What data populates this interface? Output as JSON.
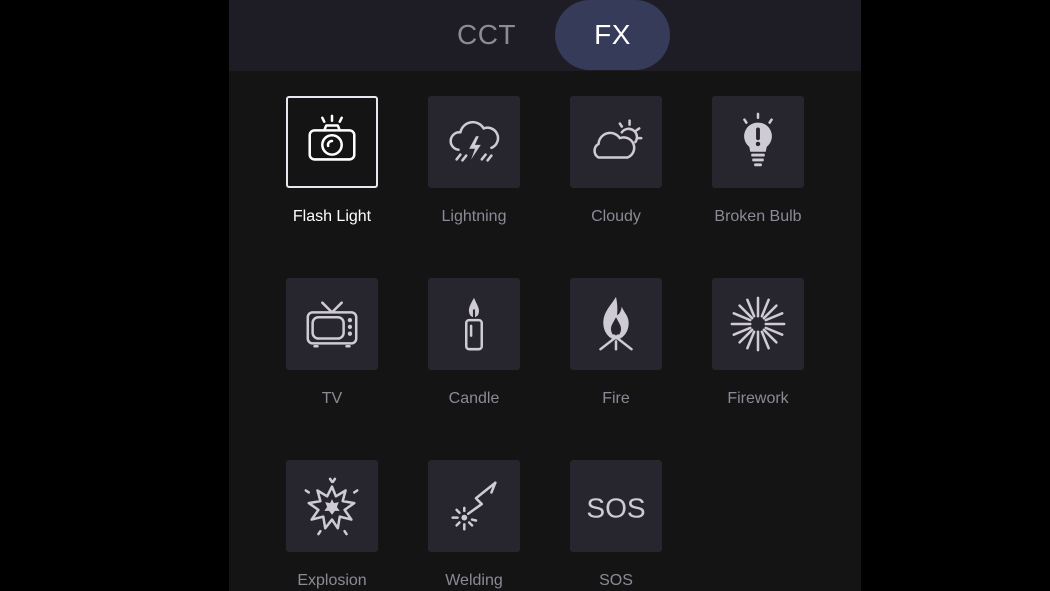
{
  "tabs": [
    {
      "label": "CCT",
      "active": false
    },
    {
      "label": "FX",
      "active": true
    }
  ],
  "effects": [
    {
      "label": "Flash Light",
      "icon": "camera-flash-icon",
      "selected": true
    },
    {
      "label": "Lightning",
      "icon": "lightning-cloud-icon",
      "selected": false
    },
    {
      "label": "Cloudy",
      "icon": "cloudy-icon",
      "selected": false
    },
    {
      "label": "Broken Bulb",
      "icon": "broken-bulb-icon",
      "selected": false
    },
    {
      "label": "TV",
      "icon": "tv-icon",
      "selected": false
    },
    {
      "label": "Candle",
      "icon": "candle-icon",
      "selected": false
    },
    {
      "label": "Fire",
      "icon": "fire-icon",
      "selected": false
    },
    {
      "label": "Firework",
      "icon": "firework-icon",
      "selected": false
    },
    {
      "label": "Explosion",
      "icon": "explosion-icon",
      "selected": false
    },
    {
      "label": "Welding",
      "icon": "welding-icon",
      "selected": false
    },
    {
      "label": "SOS",
      "icon": "sos-icon",
      "selected": false
    }
  ],
  "icon_text": {
    "sos": "SOS"
  },
  "colors": {
    "background": "#000000",
    "panel": "#141414",
    "tabbar": "#1e1d25",
    "active_tab": "#373b5a",
    "tile": "#27252d",
    "icon": "#cfcbd6",
    "label": "#8d8996",
    "selected": "#ffffff"
  }
}
